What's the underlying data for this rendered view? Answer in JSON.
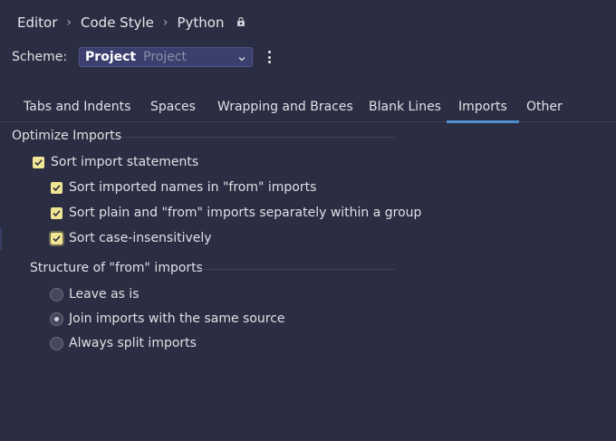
{
  "breadcrumb": {
    "items": [
      "Editor",
      "Code Style",
      "Python"
    ],
    "separator": "›",
    "lock_icon": "lock-icon"
  },
  "scheme": {
    "label": "Scheme:",
    "value_primary": "Project",
    "value_secondary": "Project",
    "dropdown_icon": "chevron-down-icon",
    "more_icon": "more-vertical-icon"
  },
  "tabs": {
    "items": [
      "Tabs and Indents",
      "Spaces",
      "Wrapping and Braces",
      "Blank Lines",
      "Imports",
      "Other"
    ],
    "active": "Imports"
  },
  "optimize": {
    "title": "Optimize Imports",
    "sort_imports": {
      "label": "Sort import statements",
      "checked": true
    },
    "sort_names": {
      "label": "Sort imported names in \"from\" imports",
      "checked": true
    },
    "sort_plain": {
      "label": "Sort plain and \"from\" imports separately within a group",
      "checked": true
    },
    "sort_case": {
      "label": "Sort case-insensitively",
      "checked": true
    }
  },
  "structure": {
    "title": "Structure of \"from\" imports",
    "options": [
      {
        "label": "Leave as is",
        "selected": false
      },
      {
        "label": "Join imports with the same source",
        "selected": true
      },
      {
        "label": "Always split imports",
        "selected": false
      }
    ]
  },
  "colors": {
    "background": "#2b2d42",
    "checkbox": "#f0e592",
    "tab_underline": "#4e8fd0",
    "select_bg": "#3b3f6e"
  }
}
